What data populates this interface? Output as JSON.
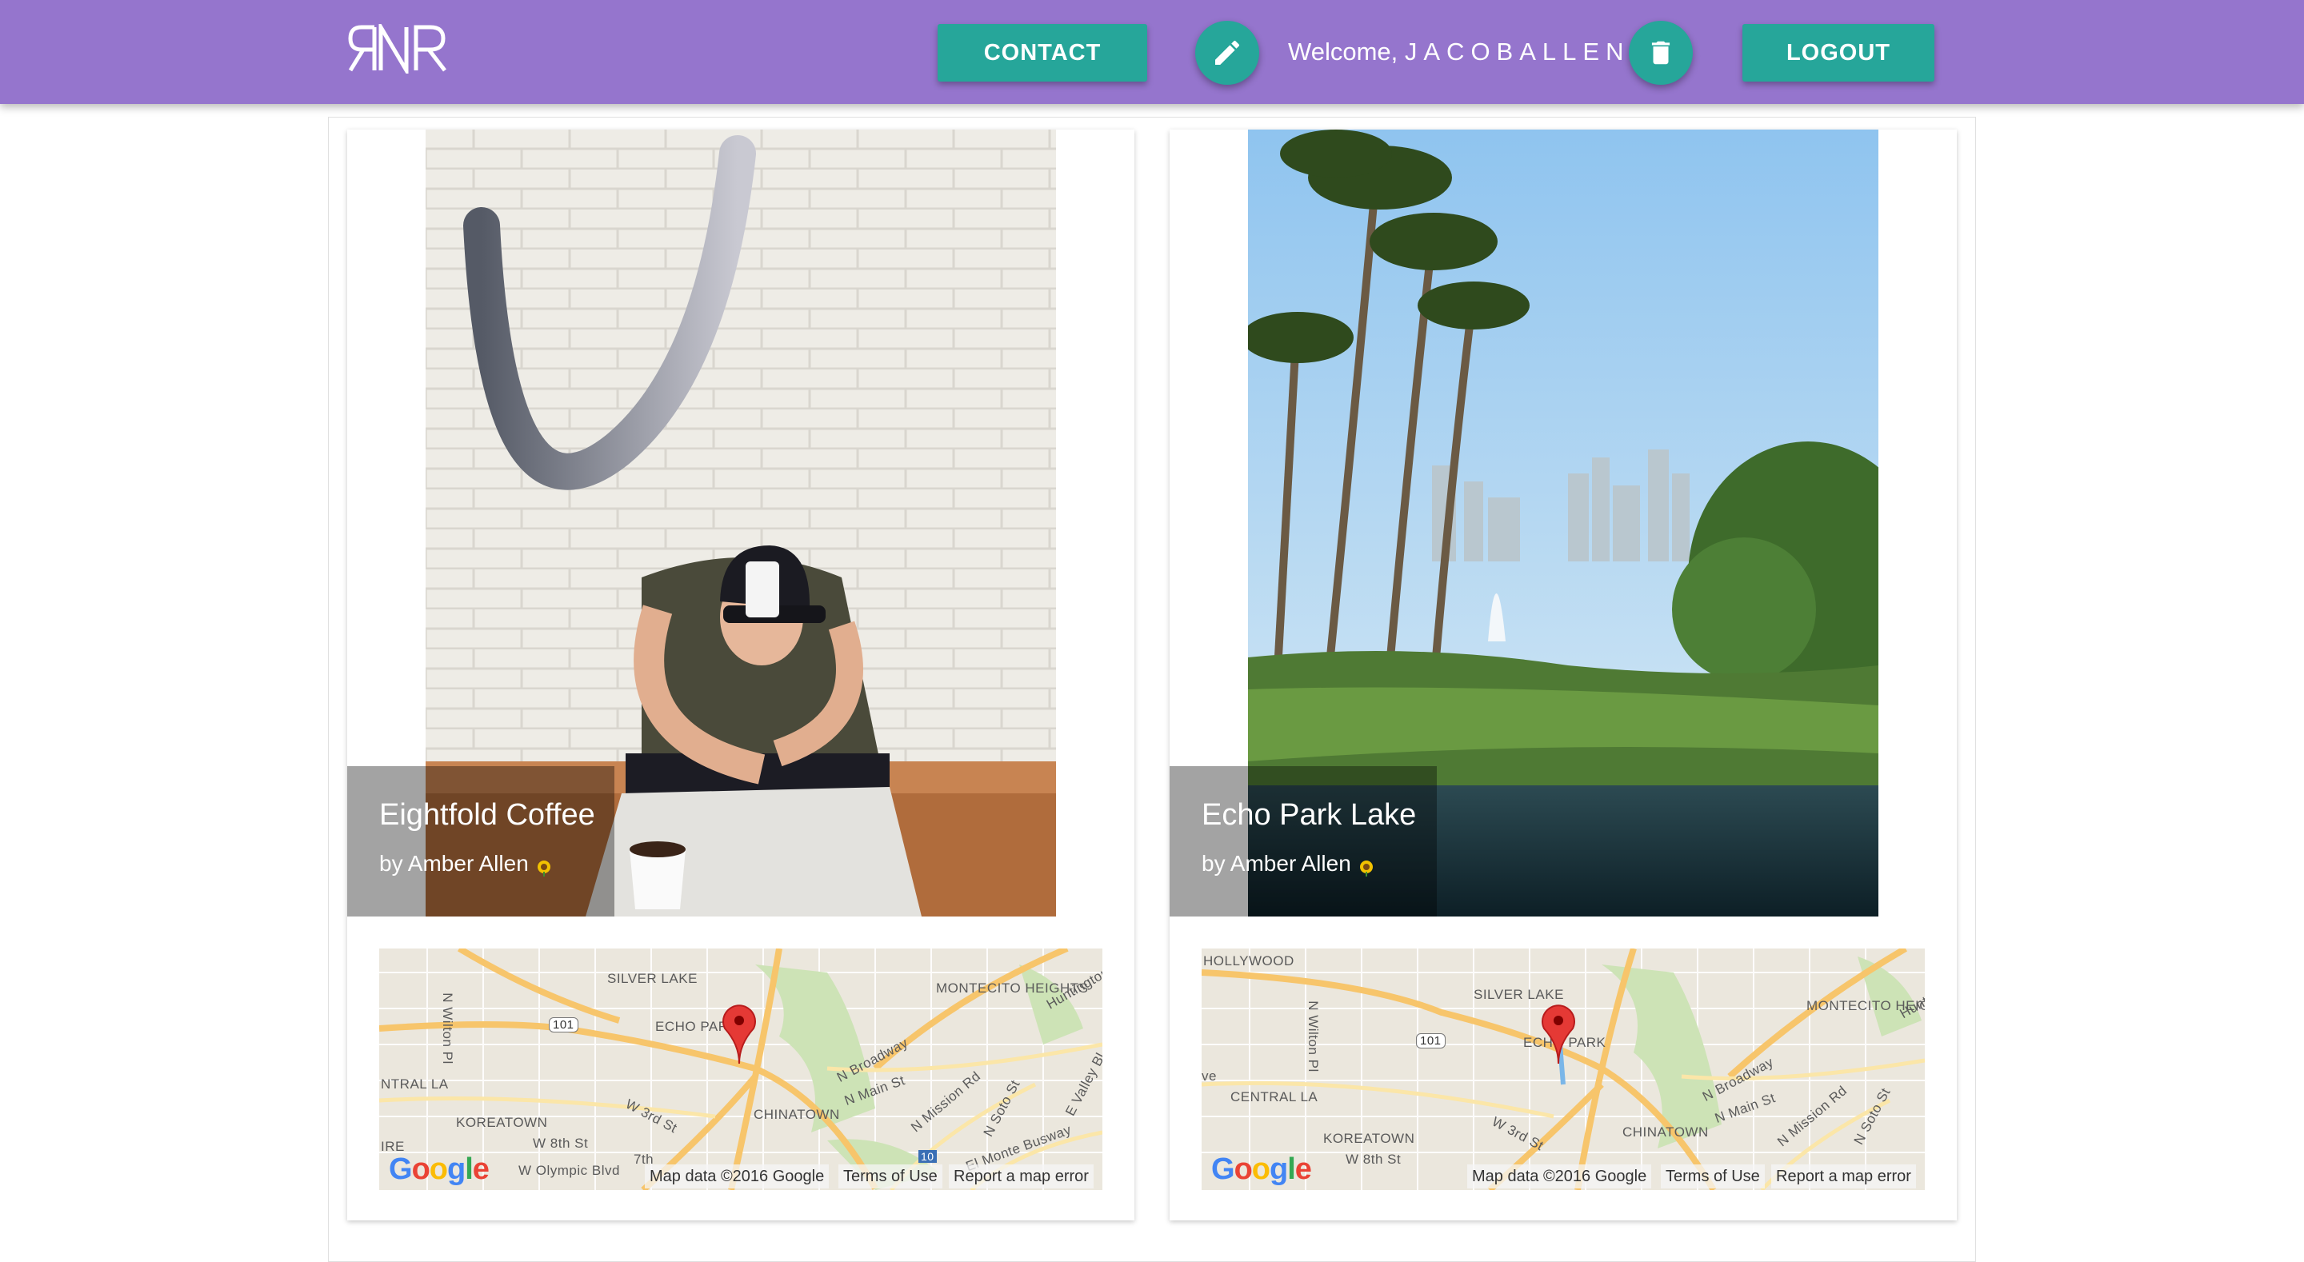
{
  "nav": {
    "logo_text": "RNR",
    "contact_label": "CONTACT",
    "welcome_prefix": "Welcome,",
    "welcome_name": "JACOBALLEN",
    "logout_label": "LOGOUT",
    "edit_icon": "pencil-icon",
    "delete_icon": "trash-icon"
  },
  "colors": {
    "navbar": "#9575cd",
    "accent": "#26a69a"
  },
  "cards": [
    {
      "title": "Eightfold Coffee",
      "author": "by Amber Allen",
      "author_icon": "sunflower-icon",
      "map": {
        "labels": [
          "SILVER LAKE",
          "MONTECITO HEIGHTS",
          "ECHO PARK",
          "101",
          "NTRAL LA",
          "KOREATOWN",
          "W 8th St",
          "CHINATOWN",
          "W 3rd St",
          "N Broadway",
          "N Main St",
          "N Mission Rd",
          "N Soto St",
          "E Valley Bl",
          "El Monte Busway",
          "W Olympic Blvd",
          "N Wilton Pl",
          "Huntington",
          "7th",
          "10",
          "IRE"
        ],
        "attribution": "Map data ©2016 Google",
        "terms": "Terms of Use",
        "report": "Report a map error"
      }
    },
    {
      "title": "Echo Park Lake",
      "author": "by Amber Allen",
      "author_icon": "sunflower-icon",
      "map": {
        "labels": [
          "HOLLYWOOD",
          "SILVER LAKE",
          "MONTECITO HEIGHTS",
          "ECHO PARK",
          "101",
          "CENTRAL LA",
          "KOREATOWN",
          "W 8th St",
          "CHINATOWN",
          "W 3rd St",
          "N Broadway",
          "N Main St",
          "N Mission Rd",
          "N Soto St",
          "N Wilton Pl",
          "Hunt",
          "ve"
        ],
        "attribution": "Map data ©2016 Google",
        "terms": "Terms of Use",
        "report": "Report a map error"
      }
    }
  ]
}
